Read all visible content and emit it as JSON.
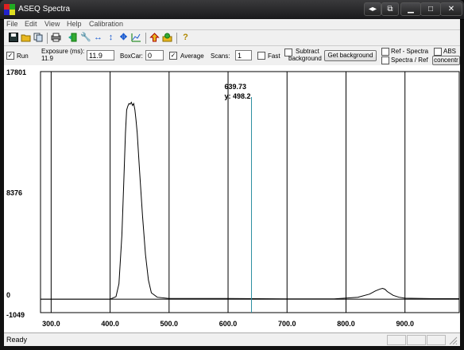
{
  "window": {
    "title": "ASEQ Spectra"
  },
  "menu": [
    "File",
    "Edit",
    "View",
    "Help",
    "Calibration"
  ],
  "toolbar_icons": [
    "save-icon",
    "open-folder-icon",
    "copy-icon",
    "print-icon",
    "exit-icon",
    "wrench-icon",
    "horizontal-arrows-icon",
    "vertical-arrows-icon",
    "move-arrows-icon",
    "autoscale-icon",
    "upload-icon",
    "settings-icon",
    "help-icon"
  ],
  "controls": {
    "run_label": "Run",
    "run_checked": true,
    "exposure_label": "Exposure (ms):",
    "exposure_sub": "11.9",
    "exposure_value": "11.9",
    "boxcar_label": "BoxCar:",
    "boxcar_value": "0",
    "average_label": "Average",
    "average_checked": true,
    "scans_label": "Scans:",
    "scans_value": "1",
    "fast_label": "Fast",
    "subtract_label_1": "Subtract",
    "subtract_label_2": "background",
    "get_background_label": "Get background",
    "ref_spectra_label": "Ref - Spectra",
    "spectra_ref_label": "Spectra / Ref",
    "abs_label": "ABS",
    "concentration_label": "concentr"
  },
  "cursor": {
    "x_text": "639.73",
    "y_text": "y: 498.2",
    "x": 639.73,
    "color": "#2a8ea0"
  },
  "chart_data": {
    "type": "line",
    "xlim": [
      282,
      992
    ],
    "ylim": [
      -1049,
      17801
    ],
    "ytick_labels": [
      "17801",
      "8376",
      "0",
      "-1049"
    ],
    "yticks": [
      17801,
      8376,
      0,
      -1049
    ],
    "xtick_labels": [
      "300.0",
      "400.0",
      "500.0",
      "600.0",
      "700.0",
      "800.0",
      "900.0"
    ],
    "xticks": [
      300,
      400,
      500,
      600,
      700,
      800,
      900
    ],
    "series": [
      {
        "color": "#000000",
        "x": [
          282,
          350,
          400,
          410,
          415,
          420,
          423,
          426,
          428,
          430,
          432,
          434,
          436,
          438,
          440,
          442,
          444,
          446,
          450,
          455,
          460,
          465,
          470,
          480,
          500,
          600,
          700,
          780,
          820,
          840,
          850,
          858,
          862,
          866,
          870,
          880,
          890,
          900,
          950,
          992
        ],
        "y": [
          0,
          0,
          0,
          200,
          1200,
          5000,
          9000,
          13000,
          14800,
          15100,
          15300,
          15250,
          15400,
          15150,
          15300,
          14800,
          14000,
          13000,
          10000,
          6500,
          3500,
          1500,
          500,
          150,
          50,
          50,
          30,
          30,
          150,
          400,
          650,
          800,
          850,
          780,
          600,
          300,
          150,
          80,
          40,
          40
        ]
      }
    ]
  },
  "status": {
    "text": "Ready"
  }
}
